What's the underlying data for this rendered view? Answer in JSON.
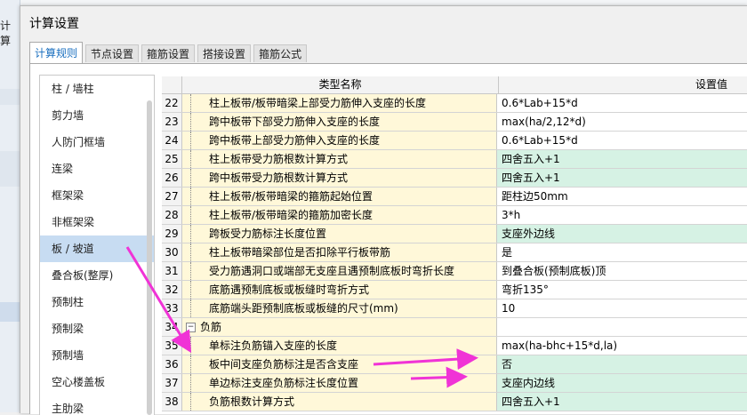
{
  "app": {
    "bg_title": "计算"
  },
  "dialog": {
    "title": "计算设置"
  },
  "tabs": [
    {
      "label": "计算规则"
    },
    {
      "label": "节点设置"
    },
    {
      "label": "箍筋设置"
    },
    {
      "label": "搭接设置"
    },
    {
      "label": "箍筋公式"
    }
  ],
  "left_list": [
    {
      "label": "柱 / 墙柱"
    },
    {
      "label": "剪力墙"
    },
    {
      "label": "人防门框墙"
    },
    {
      "label": "连梁"
    },
    {
      "label": "框架梁"
    },
    {
      "label": "非框架梁"
    },
    {
      "label": "板 / 坡道"
    },
    {
      "label": "叠合板(整厚)"
    },
    {
      "label": "预制柱"
    },
    {
      "label": "预制梁"
    },
    {
      "label": "预制墙"
    },
    {
      "label": "空心楼盖板"
    },
    {
      "label": "主肋梁"
    }
  ],
  "grid": {
    "col_name": "类型名称",
    "col_value": "设置值",
    "rows": [
      {
        "num": "22",
        "name": "柱上板带/板带暗梁上部受力筋伸入支座的长度",
        "value": "0.6*Lab+15*d",
        "highlight": false
      },
      {
        "num": "23",
        "name": "跨中板带下部受力筋伸入支座的长度",
        "value": "max(ha/2,12*d)",
        "highlight": false
      },
      {
        "num": "24",
        "name": "跨中板带上部受力筋伸入支座的长度",
        "value": "0.6*Lab+15*d",
        "highlight": false
      },
      {
        "num": "25",
        "name": "柱上板带受力筋根数计算方式",
        "value": "四舍五入+1",
        "highlight": true
      },
      {
        "num": "26",
        "name": "跨中板带受力筋根数计算方式",
        "value": "四舍五入+1",
        "highlight": true
      },
      {
        "num": "27",
        "name": "柱上板带/板带暗梁的箍筋起始位置",
        "value": "距柱边50mm",
        "highlight": false
      },
      {
        "num": "28",
        "name": "柱上板带/板带暗梁的箍筋加密长度",
        "value": "3*h",
        "highlight": false
      },
      {
        "num": "29",
        "name": "跨板受力筋标注长度位置",
        "value": "支座外边线",
        "highlight": true
      },
      {
        "num": "30",
        "name": "柱上板带暗梁部位是否扣除平行板带筋",
        "value": "是",
        "highlight": false
      },
      {
        "num": "31",
        "name": "受力筋遇洞口或端部无支座且遇预制底板时弯折长度",
        "value": "到叠合板(预制底板)顶",
        "highlight": false
      },
      {
        "num": "32",
        "name": "底筋遇预制底板或板缝时弯折方式",
        "value": "弯折135°",
        "highlight": false
      },
      {
        "num": "33",
        "name": "底筋端头距预制底板或板缝的尺寸(mm)",
        "value": "10",
        "highlight": false
      },
      {
        "num": "34",
        "group": true,
        "name": "负筋",
        "toggle": "−"
      },
      {
        "num": "35",
        "name": "单标注负筋锚入支座的长度",
        "value": "max(ha-bhc+15*d,la)",
        "highlight": false
      },
      {
        "num": "36",
        "name": "板中间支座负筋标注是否含支座",
        "value": "否",
        "highlight": true
      },
      {
        "num": "37",
        "name": "单边标注支座负筋标注长度位置",
        "value": "支座内边线",
        "highlight": true
      },
      {
        "num": "38",
        "name": "负筋根数计算方式",
        "value": "四舍五入+1",
        "highlight": true
      }
    ]
  },
  "colors": {
    "name_bg": "#fff8d9",
    "value_highlight": "#d6f2e4",
    "selection": "#c7dcf2",
    "arrow": "#f033d6",
    "active_tab_text": "#1a6fbf"
  }
}
